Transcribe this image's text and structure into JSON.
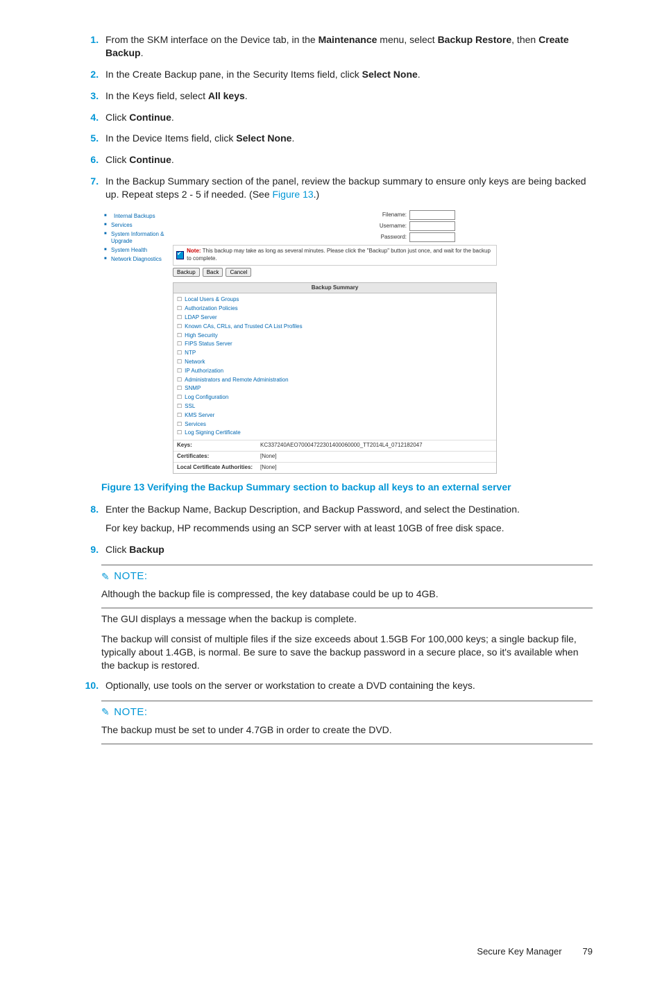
{
  "steps": {
    "s1a": "From the SKM interface on the Device tab, in the ",
    "s1b": "Maintenance",
    "s1c": " menu, select ",
    "s1d": "Backup Restore",
    "s1e": ", then ",
    "s1f": "Create Backup",
    "s1g": ".",
    "s2a": "In the Create Backup pane, in the Security Items field, click ",
    "s2b": "Select None",
    "s2c": ".",
    "s3a": "In the Keys field, select ",
    "s3b": "All keys",
    "s3c": ".",
    "s4a": "Click ",
    "s4b": "Continue",
    "s4c": ".",
    "s5a": "In the Device Items field, click ",
    "s5b": "Select None",
    "s5c": ".",
    "s6a": "Click ",
    "s6b": "Continue",
    "s6c": ".",
    "s7a": "In the Backup Summary section of the panel, review the backup summary to ensure only keys are being backed up. Repeat steps 2 - 5 if needed. (See ",
    "s7link": "Figure 13",
    "s7b": ".)",
    "s8a": "Enter the Backup Name, Backup Description, and Backup Password, and select the Destination.",
    "s8p": "For key backup, HP recommends using an SCP server with at least 10GB of free disk space.",
    "s9a": "Click ",
    "s9b": "Backup",
    "s10": "Optionally, use tools on the server or workstation to create a DVD containing the keys."
  },
  "figcaption": "Figure 13 Verifying the Backup Summary section to backup all keys to an external server",
  "note1": {
    "head": "NOTE:",
    "p1": "Although the backup file is compressed, the key database could be up to 4GB.",
    "p2": "The GUI displays a message when the backup is complete.",
    "p3": "The backup will consist of multiple files if the size exceeds about 1.5GB For 100,000 keys; a single backup file, typically about 1.4GB, is normal. Be sure to save the backup password in a secure place, so it's available when the backup is restored."
  },
  "note2": {
    "head": "NOTE:",
    "p1": "The backup must be set to under 4.7GB in order to create the DVD."
  },
  "footer": {
    "left": "Secure Key Manager",
    "right": "79"
  },
  "shot": {
    "side": [
      "Internal Backups",
      "Services",
      "System Information & Upgrade",
      "System Health",
      "Network Diagnostics"
    ],
    "fields": {
      "f1": "Filename:",
      "f2": "Username:",
      "f3": "Password:"
    },
    "warn_bold": "Note:",
    "warn_text": " This backup may take as long as several minutes. Please click the \"Backup\" button just once, and wait for the backup to complete.",
    "btns": [
      "Backup",
      "Back",
      "Cancel"
    ],
    "panel_h": "Backup Summary",
    "items": [
      "Local Users & Groups",
      "Authorization Policies",
      "LDAP Server",
      "Known CAs, CRLs, and Trusted CA List Profiles",
      "High Security",
      "FIPS Status Server",
      "NTP",
      "Network",
      "IP Authorization",
      "Administrators and Remote Administration",
      "SNMP",
      "Log Configuration",
      "SSL",
      "KMS Server",
      "Services",
      "Log Signing Certificate"
    ],
    "kv": {
      "k1": "Keys:",
      "v1": "KC337240AEO70004722301400060000_TT2014L4_0712182047",
      "k2": "Certificates:",
      "v2": "[None]",
      "k3": "Local Certificate Authorities:",
      "v3": "[None]"
    }
  }
}
